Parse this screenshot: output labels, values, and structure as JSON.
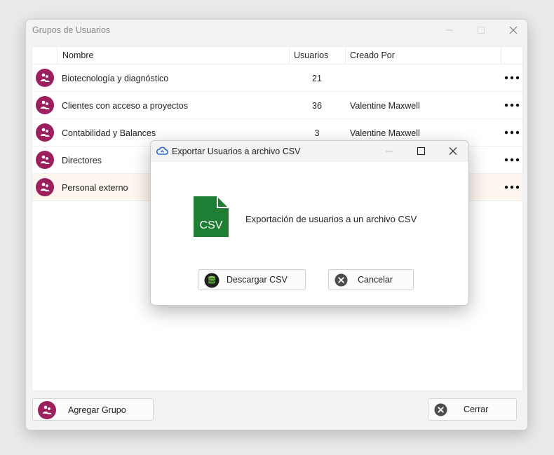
{
  "window": {
    "title": "Grupos de Usuarios"
  },
  "table": {
    "columns": [
      "Nombre",
      "Usuarios",
      "Creado Por"
    ],
    "rows": [
      {
        "name": "Biotecnología y diagnóstico",
        "users": "21",
        "created_by": ""
      },
      {
        "name": "Clientes con acceso a proyectos",
        "users": "36",
        "created_by": "Valentine Maxwell"
      },
      {
        "name": "Contabilidad y Balances",
        "users": "3",
        "created_by": "Valentine Maxwell"
      },
      {
        "name": "Directores",
        "users": "",
        "created_by": ""
      },
      {
        "name": "Personal externo",
        "users": "",
        "created_by": ""
      }
    ],
    "more_label": "•••"
  },
  "footer": {
    "add_group_label": "Agregar Grupo",
    "close_label": "Cerrar"
  },
  "dialog": {
    "title": "Exportar Usuarios a archivo CSV",
    "message": "Exportación de usuarios a un archivo CSV",
    "file_icon_text": "CSV",
    "download_label": "Descargar CSV",
    "cancel_label": "Cancelar"
  },
  "colors": {
    "avatar": "#9c1f5e",
    "csv_icon": "#1e7e34",
    "selected_row": "#fdf6ee"
  },
  "icons": {
    "group": "group-users-icon",
    "more": "more-dots-icon",
    "close_circle": "close-circle-icon",
    "database": "database-icon",
    "cloud": "cloud-sync-icon",
    "file_csv": "csv-file-icon"
  }
}
